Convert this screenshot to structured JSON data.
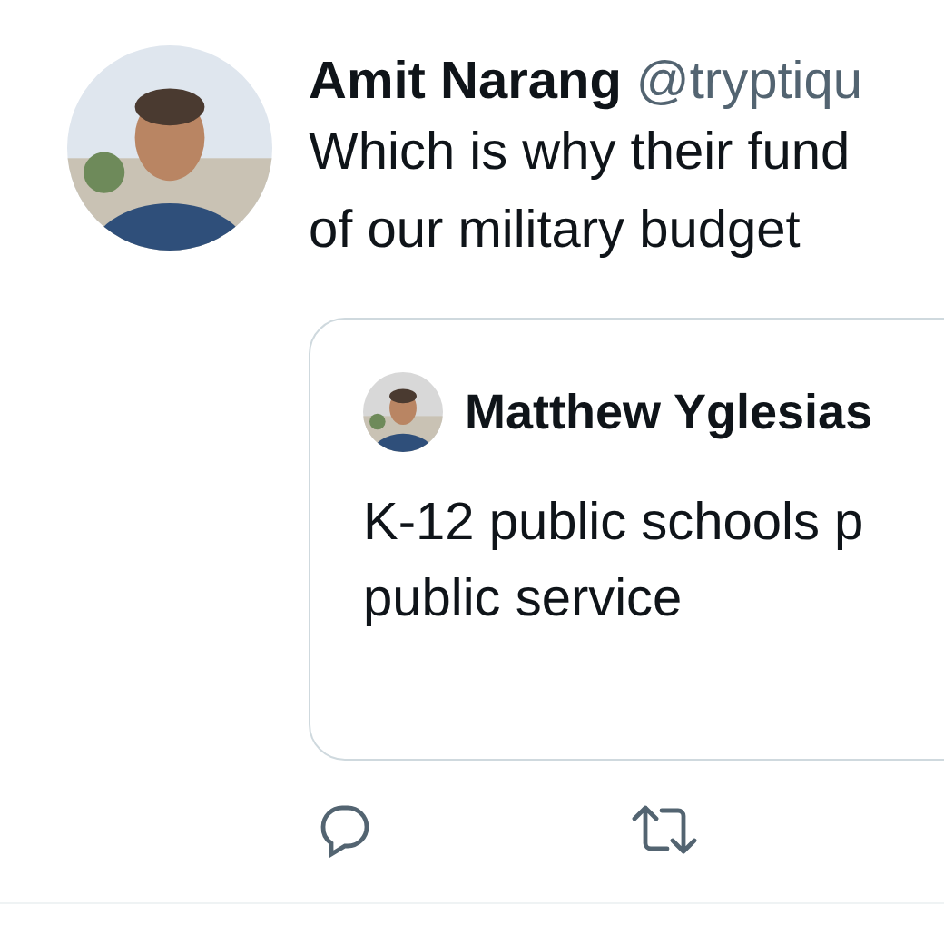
{
  "tweet": {
    "author": {
      "name": "Amit Narang",
      "handle": "@tryptiqu"
    },
    "text_lines": [
      "Which is why their fund",
      "of our military budget"
    ],
    "quoted": {
      "author": {
        "name": "Matthew Yglesias"
      },
      "text_lines": [
        "K-12 public schools p",
        "public service"
      ]
    },
    "actions": [
      {
        "kind": "reply"
      },
      {
        "kind": "retweet"
      }
    ]
  }
}
